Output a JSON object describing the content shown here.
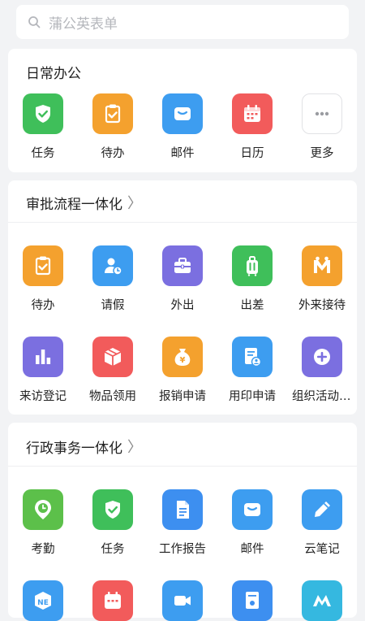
{
  "search": {
    "placeholder": "蒲公英表单",
    "icon": "search-icon"
  },
  "sections": [
    {
      "title": "日常办公",
      "items": [
        {
          "label": "任务",
          "icon": "shield-check-icon",
          "color": "#3fbf5a"
        },
        {
          "label": "待办",
          "icon": "clipboard-check-icon",
          "color": "#f4a12e"
        },
        {
          "label": "邮件",
          "icon": "mail-icon",
          "color": "#3d9df0"
        },
        {
          "label": "日历",
          "icon": "calendar-icon",
          "color": "#f25b5b"
        },
        {
          "label": "更多",
          "icon": "more-dots-icon",
          "color": "#ffffff"
        }
      ]
    },
    {
      "title": "审批流程一体化",
      "items": [
        {
          "label": "待办",
          "icon": "clipboard-check-icon",
          "color": "#f4a12e"
        },
        {
          "label": "请假",
          "icon": "person-clock-icon",
          "color": "#3d9df0"
        },
        {
          "label": "外出",
          "icon": "briefcase-icon",
          "color": "#7b6fe0"
        },
        {
          "label": "出差",
          "icon": "luggage-icon",
          "color": "#3fbf5a"
        },
        {
          "label": "外来接待",
          "icon": "reception-m-icon",
          "color": "#f4a12e"
        },
        {
          "label": "来访登记",
          "icon": "bar-chart-icon",
          "color": "#7b6fe0"
        },
        {
          "label": "物品领用",
          "icon": "box-icon",
          "color": "#f25b5b"
        },
        {
          "label": "报销申请",
          "icon": "money-bag-icon",
          "color": "#f4a12e"
        },
        {
          "label": "用印申请",
          "icon": "stamp-doc-icon",
          "color": "#3d9df0"
        },
        {
          "label": "组织活动申请",
          "icon": "plus-circle-icon",
          "color": "#7b6fe0"
        }
      ]
    },
    {
      "title": "行政事务一体化",
      "items": [
        {
          "label": "考勤",
          "icon": "location-clock-icon",
          "color": "#5cc04a"
        },
        {
          "label": "任务",
          "icon": "shield-check-icon",
          "color": "#3fbf5a"
        },
        {
          "label": "工作报告",
          "icon": "document-icon",
          "color": "#3d8ff0"
        },
        {
          "label": "邮件",
          "icon": "mail-icon",
          "color": "#3d9df0"
        },
        {
          "label": "云笔记",
          "icon": "pen-icon",
          "color": "#3d9df0"
        }
      ],
      "partial_icons": [
        {
          "icon": "cube-icon",
          "color": "#3d9df0"
        },
        {
          "icon": "calendar-icon",
          "color": "#f25b5b"
        },
        {
          "icon": "video-icon",
          "color": "#3d9df0"
        },
        {
          "icon": "contacts-icon",
          "color": "#3d8ff0"
        },
        {
          "icon": "logo-m-icon",
          "color": "#35b8e0"
        }
      ]
    }
  ]
}
